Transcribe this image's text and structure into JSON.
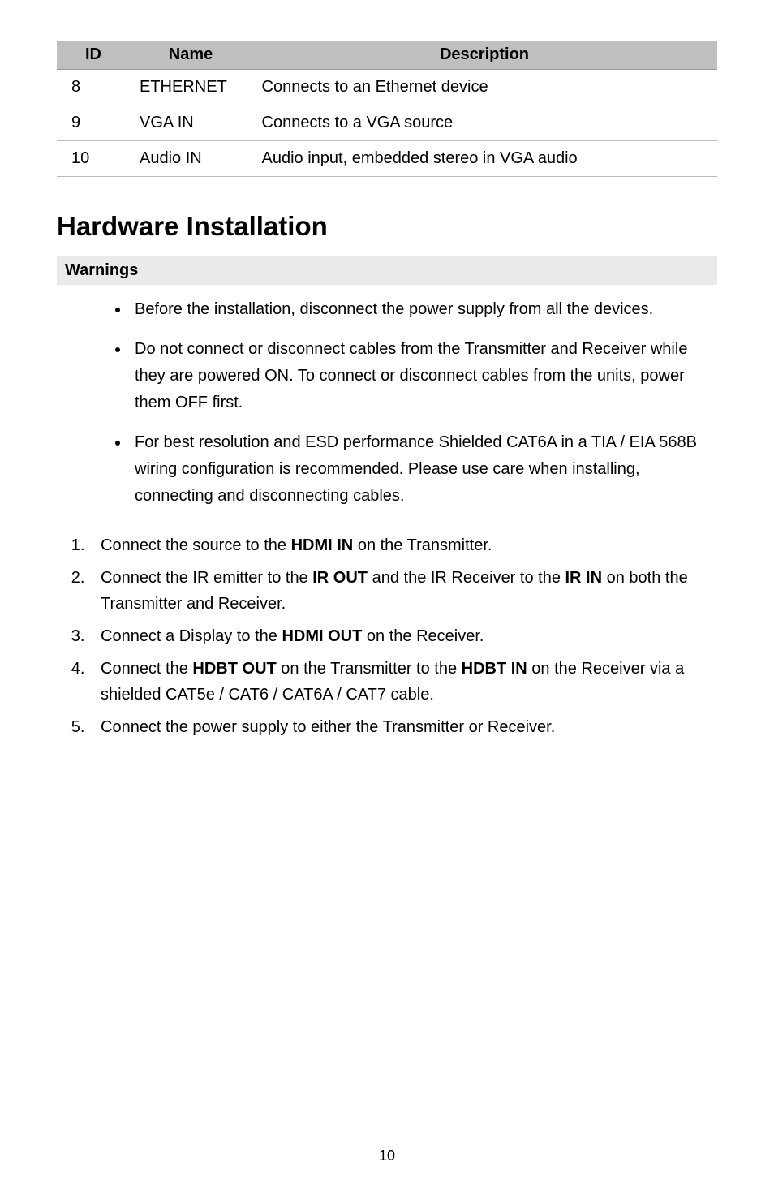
{
  "table": {
    "headers": {
      "id": "ID",
      "name": "Name",
      "desc": "Description"
    },
    "rows": [
      {
        "id": "8",
        "name": "ETHERNET",
        "desc": "Connects to an Ethernet device"
      },
      {
        "id": "9",
        "name": "VGA IN",
        "desc": "Connects to a VGA source"
      },
      {
        "id": "10",
        "name": "Audio IN",
        "desc": "Audio input, embedded stereo in VGA audio"
      }
    ]
  },
  "section_title": "Hardware Installation",
  "warnings_title": "Warnings",
  "warnings": [
    "Before the installation, disconnect the power supply from all the devices.",
    "Do not connect or disconnect cables from the Transmitter and Receiver while they are powered ON. To connect or disconnect cables from the units, power them OFF first.",
    "For best resolution and ESD performance Shielded CAT6A in a TIA / EIA 568B wiring configuration is recommended. Please use care when installing, connecting and disconnecting cables."
  ],
  "steps": [
    {
      "pre": "Connect the source to the ",
      "b1": "HDMI IN",
      "mid": " on the Transmitter.",
      "b2": "",
      "post": ""
    },
    {
      "pre": "Connect the IR emitter to the ",
      "b1": "IR OUT",
      "mid": " and the IR Receiver to the ",
      "b2": "IR IN",
      "post": " on both the Transmitter and Receiver."
    },
    {
      "pre": "Connect a Display to the ",
      "b1": "HDMI OUT",
      "mid": " on the Receiver.",
      "b2": "",
      "post": ""
    },
    {
      "pre": "Connect the ",
      "b1": "HDBT OUT",
      "mid": " on the Transmitter to the ",
      "b2": "HDBT IN",
      "post": " on the Receiver via a shielded CAT5e / CAT6 / CAT6A / CAT7 cable."
    },
    {
      "pre": "Connect the power supply to either the Transmitter or Receiver.",
      "b1": "",
      "mid": "",
      "b2": "",
      "post": ""
    }
  ],
  "page_number": "10"
}
